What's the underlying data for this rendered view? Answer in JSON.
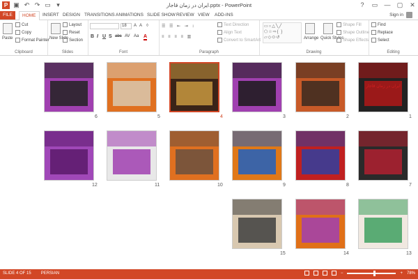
{
  "titlebar": {
    "title": "ایران در زمان قاجار.pptx - PowerPoint",
    "qat_icons": [
      "powerpoint-logo-icon",
      "save-icon",
      "undo-icon",
      "redo-icon",
      "present-icon",
      "qat-more-icon"
    ],
    "window_controls": [
      "?",
      "▭",
      "—",
      "▢",
      "✕"
    ]
  },
  "tabs": [
    "FILE",
    "HOME",
    "INSERT",
    "DESIGN",
    "TRANSITIONS",
    "ANIMATIONS",
    "SLIDE SHOW",
    "REVIEW",
    "VIEW",
    "ADD-INS"
  ],
  "active_tab": "HOME",
  "sign_in": "Sign in",
  "ribbon": {
    "clipboard": {
      "label": "Clipboard",
      "paste": "Paste",
      "cut": "Cut",
      "copy": "Copy",
      "format_painter": "Format Painter"
    },
    "slides": {
      "label": "Slides",
      "new_slide": "New Slide",
      "layout": "Layout",
      "reset": "Reset",
      "section": "Section"
    },
    "font": {
      "label": "Font",
      "size": "18",
      "buttons": [
        "B",
        "I",
        "U",
        "S",
        "abc",
        "AV",
        "Aa",
        "A"
      ]
    },
    "paragraph": {
      "label": "Paragraph",
      "text_direction": "Text Direction",
      "align_text": "Align Text",
      "convert_smartart": "Convert to SmartArt"
    },
    "drawing": {
      "label": "Drawing",
      "arrange": "Arrange",
      "quick_styles": "Quick Styles",
      "shape_fill": "Shape Fill",
      "shape_outline": "Shape Outline",
      "shape_effects": "Shape Effects"
    },
    "editing": {
      "label": "Editing",
      "find": "Find",
      "replace": "Replace",
      "select": "Select"
    }
  },
  "slides": [
    {
      "n": "1",
      "bg": "#222222",
      "accent": "#b01818",
      "title": "ایران در زمان قاجار"
    },
    {
      "n": "2",
      "bg": "#c85a28",
      "accent": "#3a2a20"
    },
    {
      "n": "3",
      "bg": "#a040b0",
      "accent": "#1a1a1a"
    },
    {
      "n": "4",
      "bg": "#3a2418",
      "accent": "#c89840"
    },
    {
      "n": "5",
      "bg": "#e07020",
      "accent": "#d8c8b0"
    },
    {
      "n": "6",
      "bg": "#a040b0",
      "accent": "#222222"
    },
    {
      "n": "7",
      "bg": "#2a2a2a",
      "accent": "#b02030"
    },
    {
      "n": "8",
      "bg": "#c02020",
      "accent": "#3040a0"
    },
    {
      "n": "9",
      "bg": "#e07818",
      "accent": "#2060c0"
    },
    {
      "n": "10",
      "bg": "#e07020",
      "accent": "#6a5040"
    },
    {
      "n": "11",
      "bg": "#e8e8e8",
      "accent": "#a040b0"
    },
    {
      "n": "12",
      "bg": "#a048b8",
      "accent": "#5a1a6a"
    },
    {
      "n": "13",
      "bg": "#f0e8e0",
      "accent": "#40a060"
    },
    {
      "n": "14",
      "bg": "#e07018",
      "accent": "#a040b0"
    },
    {
      "n": "15",
      "bg": "#d8c8b0",
      "accent": "#404040"
    }
  ],
  "selected_slide": "4",
  "status": {
    "slide_info": "SLIDE 4 OF 15",
    "language": "PERSIAN",
    "zoom": "78%"
  }
}
